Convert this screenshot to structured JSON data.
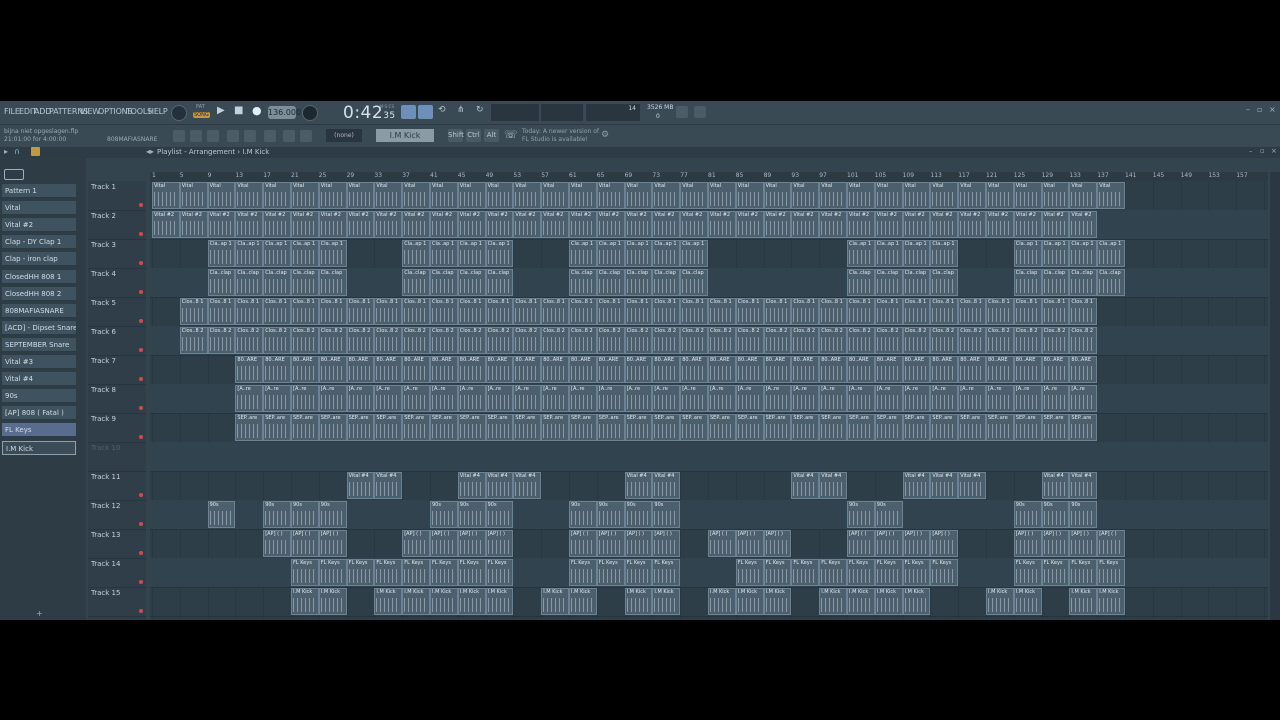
{
  "menu": [
    "FILE",
    "EDIT",
    "ADD",
    "PATTERNS",
    "VIEW",
    "OPTIONS",
    "TOOLS",
    "HELP"
  ],
  "transport": {
    "mode_top": "PAT",
    "mode_bottom": "SONG",
    "tempo": "136.000",
    "time": "0:42",
    "time_sub": "35",
    "time_unit": "M:S:CS",
    "cpu": "14",
    "memory": "3526 MB",
    "poly": "0"
  },
  "project": {
    "file": "bijna niet opgeslagen.flp",
    "time_info": "21:01:00 for 4:00:00",
    "hint_right": "808MAFIASNARE"
  },
  "toolbar2": {
    "snap": "(none)",
    "pattern": "I.M Kick",
    "keys": [
      "Shift",
      "Ctrl",
      "Alt"
    ],
    "news_line1": "Today: A newer version of",
    "news_line2": "FL Studio is available!"
  },
  "playlist": {
    "breadcrumb": "Playlist - Arrangement",
    "current_pattern": "I.M Kick",
    "bar_numbers": [
      "1",
      "5",
      "9",
      "13",
      "17",
      "21",
      "25",
      "29",
      "33",
      "37",
      "41",
      "45",
      "49",
      "53",
      "57",
      "61",
      "65",
      "69",
      "73",
      "77",
      "81",
      "85",
      "89",
      "93",
      "97",
      "101",
      "105",
      "109",
      "113",
      "117",
      "121",
      "125",
      "129",
      "133",
      "137",
      "141",
      "145",
      "149",
      "153",
      "157"
    ]
  },
  "picker": [
    {
      "label": "Pattern 1",
      "state": "normal"
    },
    {
      "label": "Vital",
      "state": "normal"
    },
    {
      "label": "Vital #2",
      "state": "normal"
    },
    {
      "label": "Clap - DY Clap 1",
      "state": "normal"
    },
    {
      "label": "Clap - iron clap",
      "state": "normal"
    },
    {
      "label": "ClosedHH 808 1",
      "state": "normal"
    },
    {
      "label": "ClosedHH 808 2",
      "state": "normal"
    },
    {
      "label": "808MAFIASNARE",
      "state": "normal"
    },
    {
      "label": "[ACD] - Dipset Snare",
      "state": "normal"
    },
    {
      "label": "SEPTEMBER Snare",
      "state": "normal"
    },
    {
      "label": "Vital #3",
      "state": "normal"
    },
    {
      "label": "Vital #4",
      "state": "normal"
    },
    {
      "label": "90s",
      "state": "normal"
    },
    {
      "label": "[AP] 808 ( Fatal )",
      "state": "normal"
    },
    {
      "label": "FL Keys",
      "state": "selected"
    },
    {
      "label": "I.M Kick",
      "state": "current"
    }
  ],
  "tracks": [
    {
      "name": "Track 1",
      "clip": "Vital",
      "bars": [
        [
          1,
          141
        ]
      ],
      "active": true
    },
    {
      "name": "Track 2",
      "clip": "Vital #2",
      "bars": [
        [
          1,
          137
        ]
      ],
      "active": true
    },
    {
      "name": "Track 3",
      "clip": "Cla..ap 1",
      "bars": [
        [
          9,
          29
        ],
        [
          37,
          53
        ],
        [
          61,
          81
        ],
        [
          101,
          117
        ],
        [
          125,
          141
        ]
      ],
      "active": true
    },
    {
      "name": "Track 4",
      "clip": "Cla..clap",
      "bars": [
        [
          9,
          29
        ],
        [
          37,
          53
        ],
        [
          61,
          81
        ],
        [
          101,
          117
        ],
        [
          125,
          141
        ]
      ],
      "active": true
    },
    {
      "name": "Track 5",
      "clip": "Clos..8 1",
      "bars": [
        [
          5,
          137
        ]
      ],
      "active": true
    },
    {
      "name": "Track 6",
      "clip": "Clos..8 2",
      "bars": [
        [
          5,
          137
        ]
      ],
      "active": true
    },
    {
      "name": "Track 7",
      "clip": "80..ARE",
      "bars": [
        [
          13,
          137
        ]
      ],
      "active": true
    },
    {
      "name": "Track 8",
      "clip": "[A..re",
      "bars": [
        [
          13,
          137
        ]
      ],
      "active": true
    },
    {
      "name": "Track 9",
      "clip": "SEP..are",
      "bars": [
        [
          13,
          137
        ]
      ],
      "active": true
    },
    {
      "name": "Track 10",
      "clip": "",
      "bars": [],
      "active": false
    },
    {
      "name": "Track 11",
      "clip": "Vital #4",
      "bars": [
        [
          29,
          37
        ],
        [
          45,
          57
        ],
        [
          69,
          77
        ],
        [
          93,
          101
        ],
        [
          109,
          121
        ],
        [
          129,
          137
        ]
      ],
      "active": true
    },
    {
      "name": "Track 12",
      "clip": "90s",
      "bars": [
        [
          9,
          13
        ],
        [
          17,
          29
        ],
        [
          41,
          53
        ],
        [
          61,
          77
        ],
        [
          101,
          109
        ],
        [
          125,
          137
        ]
      ],
      "active": true
    },
    {
      "name": "Track 13",
      "clip": "[AP] ( )",
      "bars": [
        [
          17,
          29
        ],
        [
          37,
          53
        ],
        [
          61,
          77
        ],
        [
          81,
          93
        ],
        [
          101,
          117
        ],
        [
          125,
          141
        ]
      ],
      "active": true
    },
    {
      "name": "Track 14",
      "clip": "FL Keys",
      "bars": [
        [
          21,
          53
        ],
        [
          61,
          77
        ],
        [
          85,
          117
        ],
        [
          125,
          141
        ]
      ],
      "active": true
    },
    {
      "name": "Track 15",
      "clip": "I.M Kick",
      "bars": [
        [
          21,
          29
        ],
        [
          33,
          53
        ],
        [
          57,
          65
        ],
        [
          69,
          77
        ],
        [
          81,
          93
        ],
        [
          97,
          113
        ],
        [
          121,
          129
        ],
        [
          133,
          141
        ]
      ],
      "active": true
    }
  ],
  "colors": {
    "background": "#34444f",
    "clip": "#4c5f6d",
    "mute_led": "#d14b4b",
    "selected_pattern": "#5a6c8e"
  }
}
